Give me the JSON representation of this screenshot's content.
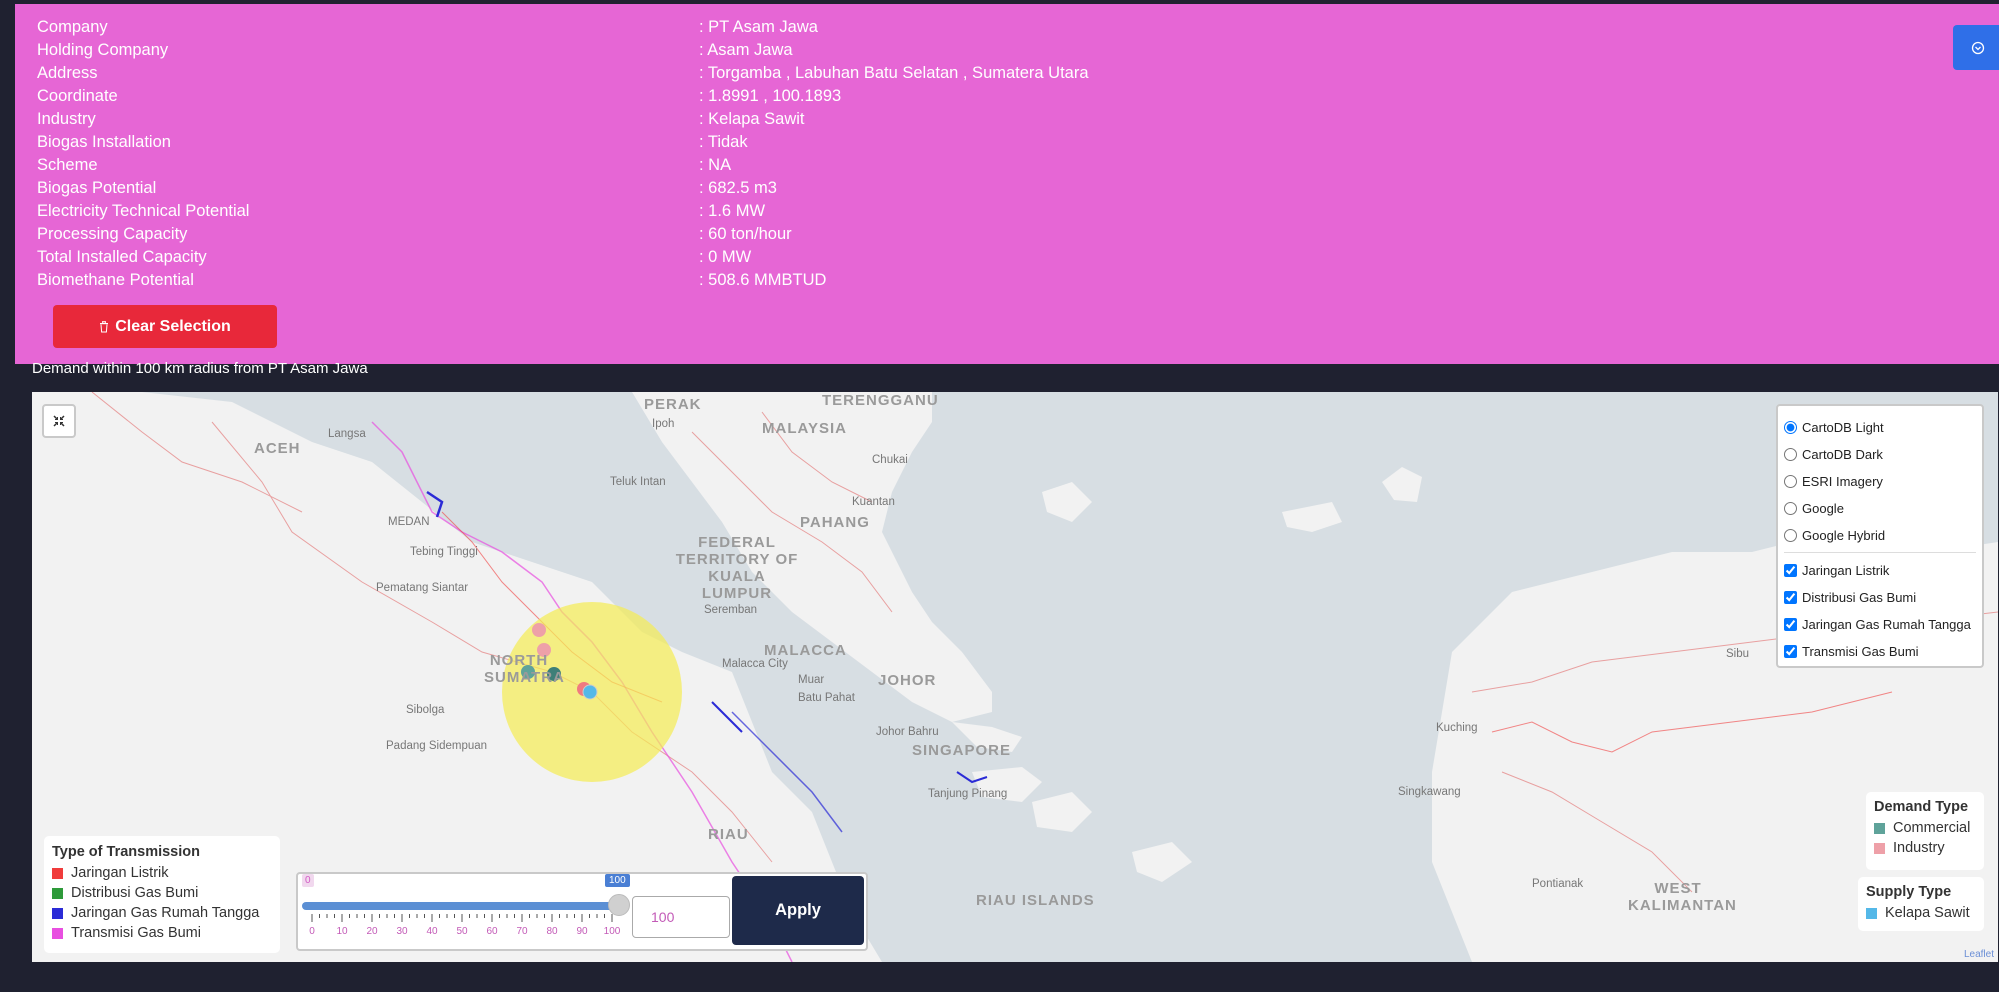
{
  "info": {
    "rows": [
      {
        "label": "Company",
        "value": "PT Asam Jawa"
      },
      {
        "label": "Holding Company",
        "value": "Asam Jawa"
      },
      {
        "label": "Address",
        "value": "Torgamba , Labuhan Batu Selatan , Sumatera Utara"
      },
      {
        "label": "Coordinate",
        "value": "1.8991 , 100.1893"
      },
      {
        "label": "Industry",
        "value": "Kelapa Sawit"
      },
      {
        "label": "Biogas Installation",
        "value": "Tidak"
      },
      {
        "label": "Scheme",
        "value": "NA"
      },
      {
        "label": "Biogas Potential",
        "value": "682.5 m3"
      },
      {
        "label": "Electricity Technical Potential",
        "value": "1.6 MW"
      },
      {
        "label": "Processing Capacity",
        "value": "60 ton/hour"
      },
      {
        "label": "Total Installed Capacity",
        "value": "0 MW"
      },
      {
        "label": "Biomethane Potential",
        "value": "508.6 MMBTUD"
      }
    ],
    "clear_button": "Clear Selection",
    "collapse_icon": "chevron-circle-icon",
    "trash_icon": "trash-icon",
    "background_color": "#e666d5"
  },
  "radius_note": "Demand within 100 km radius from PT Asam Jawa",
  "map": {
    "labels": {
      "aceh": "ACEH",
      "north_sumatra": "NORTH SUMATRA",
      "perak": "PERAK",
      "terengganu": "TERENGGANU",
      "malaysia": "MALAYSIA",
      "pahang": "PAHANG",
      "federal_territory": "FEDERAL TERRITORY OF KUALA LUMPUR",
      "malacca": "MALACCA",
      "johor": "JOHOR",
      "singapore": "SINGAPORE",
      "riau": "RIAU",
      "riau_islands": "RIAU ISLANDS",
      "west_kalimantan": "WEST KALIMANTAN",
      "langsa": "Langsa",
      "medan": "MEDAN",
      "tebing_tinggi": "Tebing Tinggi",
      "pematang_siantar": "Pematang Siantar",
      "sibolga": "Sibolga",
      "padang_sidempuan": "Padang Sidempuan",
      "ipoh": "Ipoh",
      "teluk_intan": "Teluk Intan",
      "chukai": "Chukai",
      "kuantan": "Kuantan",
      "seremban": "Seremban",
      "malacca_city": "Malacca City",
      "muar": "Muar",
      "batu_pahat": "Batu Pahat",
      "johor_bahru": "Johor Bahru",
      "tanjung_pinang": "Tanjung Pinang",
      "kuching": "Kuching",
      "sibu": "Sibu",
      "singkawang": "Singkawang",
      "pontianak": "Pontianak"
    },
    "fullscreen_icon": "fullscreen-icon",
    "base_layers": [
      "CartoDB Light",
      "CartoDB Dark",
      "ESRI Imagery",
      "Google",
      "Google Hybrid"
    ],
    "selected_base_layer": "CartoDB Light",
    "overlays": [
      "Jaringan Listrik",
      "Distribusi Gas Bumi",
      "Jaringan Gas Rumah Tangga",
      "Transmisi Gas Bumi"
    ],
    "overlays_checked": [
      true,
      true,
      true,
      true
    ],
    "attribution": "Leaflet"
  },
  "legend_transmission": {
    "title": "Type of Transmission",
    "items": [
      {
        "label": "Jaringan Listrik",
        "color": "#f03c3c"
      },
      {
        "label": "Distribusi Gas Bumi",
        "color": "#2e9a3a"
      },
      {
        "label": "Jaringan Gas Rumah Tangga",
        "color": "#2b2bd6"
      },
      {
        "label": "Transmisi Gas Bumi",
        "color": "#e84fe0"
      }
    ]
  },
  "legend_demand": {
    "title": "Demand Type",
    "items": [
      {
        "label": "Commercial",
        "color": "#5fa39a"
      },
      {
        "label": "Industry",
        "color": "#eea0a8"
      }
    ]
  },
  "legend_supply": {
    "title": "Supply Type",
    "items": [
      {
        "label": "Kelapa Sawit",
        "color": "#54b8e8"
      }
    ]
  },
  "radius_slider": {
    "min_label": "0",
    "max_label": "100",
    "value": 100,
    "ticks": [
      "0",
      "10",
      "20",
      "30",
      "40",
      "50",
      "60",
      "70",
      "80",
      "90",
      "100"
    ],
    "input_value": "100",
    "apply_label": "Apply"
  }
}
